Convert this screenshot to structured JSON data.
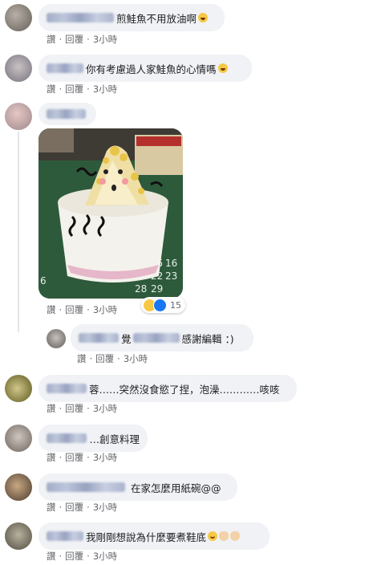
{
  "colors": {
    "bubble": "#f0f2f5",
    "meta": "#65676b",
    "text": "#1c1e21",
    "like": "#1877f2"
  },
  "actions": {
    "read": "讚",
    "reply": "回覆",
    "separator": "·"
  },
  "comments": [
    {
      "text": "煎鮭魚不用放油啊",
      "emojis": [
        "laugh-icon"
      ],
      "time": "3小時"
    },
    {
      "text": "你有考慮過人家鮭魚的心情嗎",
      "emojis": [
        "laugh-icon"
      ],
      "time": "3小時"
    },
    {
      "text": "",
      "time": "3小時",
      "reaction_count": "15"
    },
    {
      "reply_prefix": "覺",
      "text": "感謝編輯 ：)",
      "time": "3小時"
    },
    {
      "text": "蓉……突然沒食慾了捏，泡澡…………咳咳",
      "time": "3小時"
    },
    {
      "text": "…創意料理",
      "time": "3小時"
    },
    {
      "text": "在家怎麼用紙碗@@",
      "time": "3小時"
    },
    {
      "text": "我剛剛想說為什麼要煮鞋底",
      "emojis": [
        "smile-icon",
        "hand-icon",
        "hand-icon"
      ],
      "time": "3小時"
    }
  ]
}
